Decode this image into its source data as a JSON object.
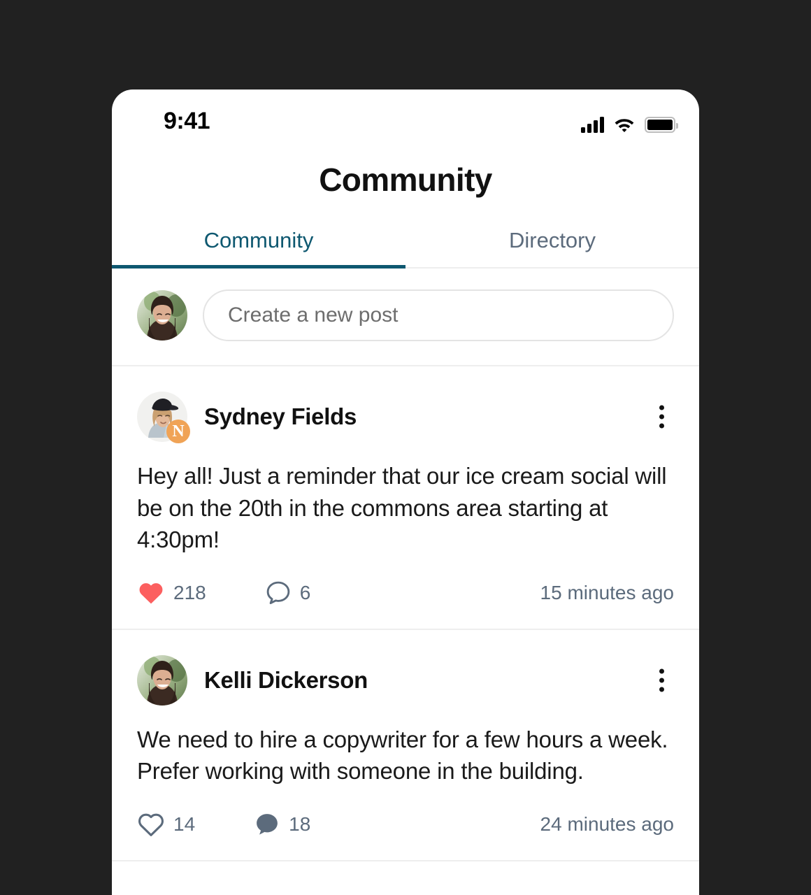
{
  "theme": {
    "page_background": "#212121",
    "surface": "#ffffff",
    "accent": "#0e5870",
    "muted_text": "#5c6b7c",
    "heart_active": "#fc5f5f",
    "badge_background": "#f0a356",
    "divider": "#eeeeee"
  },
  "status_bar": {
    "time": "9:41",
    "signal_icon": "cellular-signal-icon",
    "wifi_icon": "wifi-icon",
    "battery_icon": "battery-full-icon"
  },
  "header": {
    "title": "Community"
  },
  "tabs": {
    "active_index": 0,
    "items": [
      {
        "label": "Community",
        "active": true
      },
      {
        "label": "Directory",
        "active": false
      }
    ]
  },
  "compose": {
    "avatar_alt": "current-user-avatar",
    "placeholder": "Create a new post",
    "value": ""
  },
  "posts": [
    {
      "author": "Sydney Fields",
      "avatar_alt": "sydney-fields-avatar",
      "badge": "N",
      "has_badge": true,
      "body": "Hey all! Just a reminder that our ice cream social will be on the 20th in the commons area starting at 4:30pm!",
      "likes": "218",
      "liked": true,
      "comments": "6",
      "commented": false,
      "timestamp": "15 minutes ago",
      "menu_icon": "more-vertical-icon"
    },
    {
      "author": "Kelli Dickerson",
      "avatar_alt": "kelli-dickerson-avatar",
      "badge": "",
      "has_badge": false,
      "body": "We need to hire a copywriter for a few hours a week. Prefer working with someone in the building.",
      "likes": "14",
      "liked": false,
      "comments": "18",
      "commented": true,
      "timestamp": "24 minutes ago",
      "menu_icon": "more-vertical-icon"
    }
  ],
  "icons": {
    "heart": "heart-icon",
    "comment": "comment-bubble-icon"
  }
}
